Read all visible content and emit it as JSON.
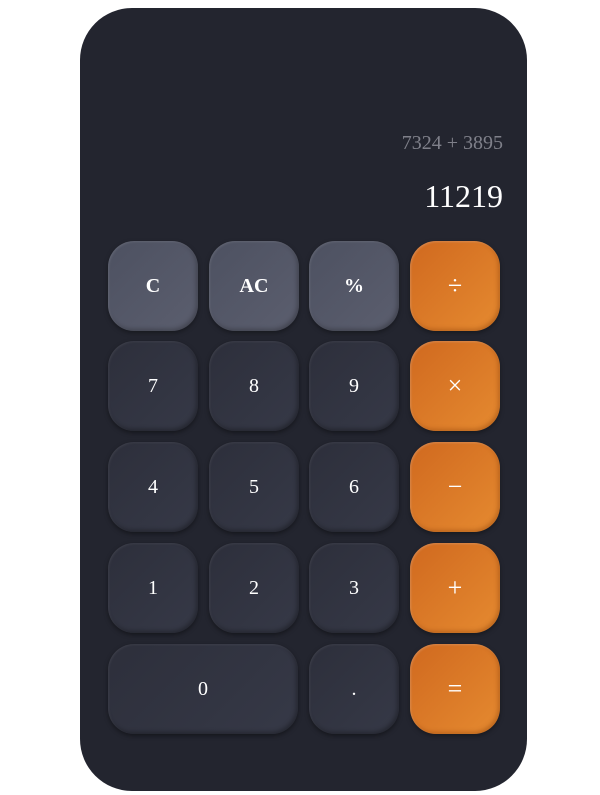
{
  "display": {
    "expression": "7324 + 3895",
    "result": "11219"
  },
  "keys": {
    "clear": "C",
    "all_clear": "AC",
    "percent": "%",
    "divide": "÷",
    "seven": "7",
    "eight": "8",
    "nine": "9",
    "multiply": "×",
    "four": "4",
    "five": "5",
    "six": "6",
    "subtract": "−",
    "one": "1",
    "two": "2",
    "three": "3",
    "add": "+",
    "zero": "0",
    "decimal": ".",
    "equals": "="
  },
  "colors": {
    "body": "#23252f",
    "function_key": "#545767",
    "number_key": "#31333f",
    "operator_key": "#dc7a28",
    "expression_text": "#7f808a",
    "result_text": "#ffffff"
  }
}
